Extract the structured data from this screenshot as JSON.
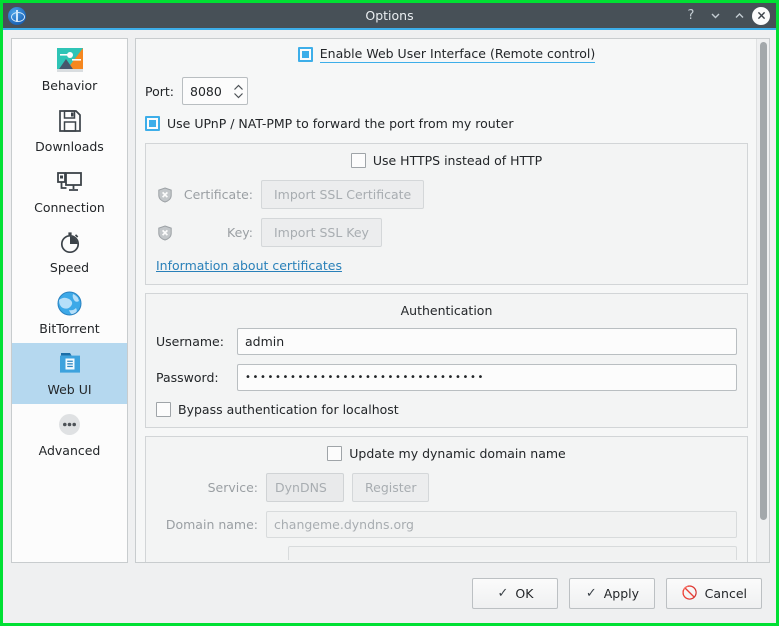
{
  "window": {
    "title": "Options",
    "app_icon": "qbittorrent-logo-icon",
    "controls": [
      {
        "name": "help-button",
        "glyph": "?"
      },
      {
        "name": "minimize-button",
        "glyph": "v"
      },
      {
        "name": "maximize-button",
        "glyph": "^"
      },
      {
        "name": "close-button",
        "glyph": "x"
      }
    ]
  },
  "sidebar": {
    "items": [
      {
        "label": "Behavior",
        "icon": "behavior-image-icon",
        "selected": false
      },
      {
        "label": "Downloads",
        "icon": "floppy-save-icon",
        "selected": false
      },
      {
        "label": "Connection",
        "icon": "network-computer-icon",
        "selected": false
      },
      {
        "label": "Speed",
        "icon": "stopwatch-icon",
        "selected": false
      },
      {
        "label": "BitTorrent",
        "icon": "globe-icon",
        "selected": false
      },
      {
        "label": "Web UI",
        "icon": "web-folder-icon",
        "selected": true
      },
      {
        "label": "Advanced",
        "icon": "ellipsis-circle-icon",
        "selected": false
      }
    ]
  },
  "webui": {
    "enable_checkbox": {
      "label": "Enable Web User Interface (Remote control)",
      "checked": true,
      "focused": true
    },
    "port": {
      "label": "Port:",
      "value": "8080"
    },
    "upnp_checkbox": {
      "label": "Use UPnP / NAT-PMP to forward the port from my router",
      "checked": true
    },
    "https_group": {
      "https_checkbox": {
        "label": "Use HTTPS instead of HTTP",
        "checked": false
      },
      "certificate": {
        "label": "Certificate:",
        "button": "Import SSL Certificate",
        "icon": "shield-disabled-icon",
        "disabled": true
      },
      "key": {
        "label": "Key:",
        "button": "Import SSL Key",
        "icon": "shield-disabled-icon",
        "disabled": true
      },
      "info_link": "Information about certificates"
    },
    "authentication": {
      "title": "Authentication",
      "username": {
        "label": "Username:",
        "value": "admin"
      },
      "password": {
        "label": "Password:",
        "value": "••••••••••••••••••••••••••••••••"
      },
      "bypass_checkbox": {
        "label": "Bypass authentication for localhost",
        "checked": false
      }
    },
    "dyndns": {
      "update_checkbox": {
        "label": "Update my dynamic domain name",
        "checked": false
      },
      "service": {
        "label": "Service:",
        "value": "DynDNS",
        "disabled": true
      },
      "register_button": {
        "label": "Register",
        "disabled": true
      },
      "domain_name": {
        "label": "Domain name:",
        "placeholder": "changeme.dyndns.org",
        "value": "",
        "disabled": true
      }
    }
  },
  "footer": {
    "ok": "OK",
    "apply": "Apply",
    "cancel": "Cancel"
  }
}
